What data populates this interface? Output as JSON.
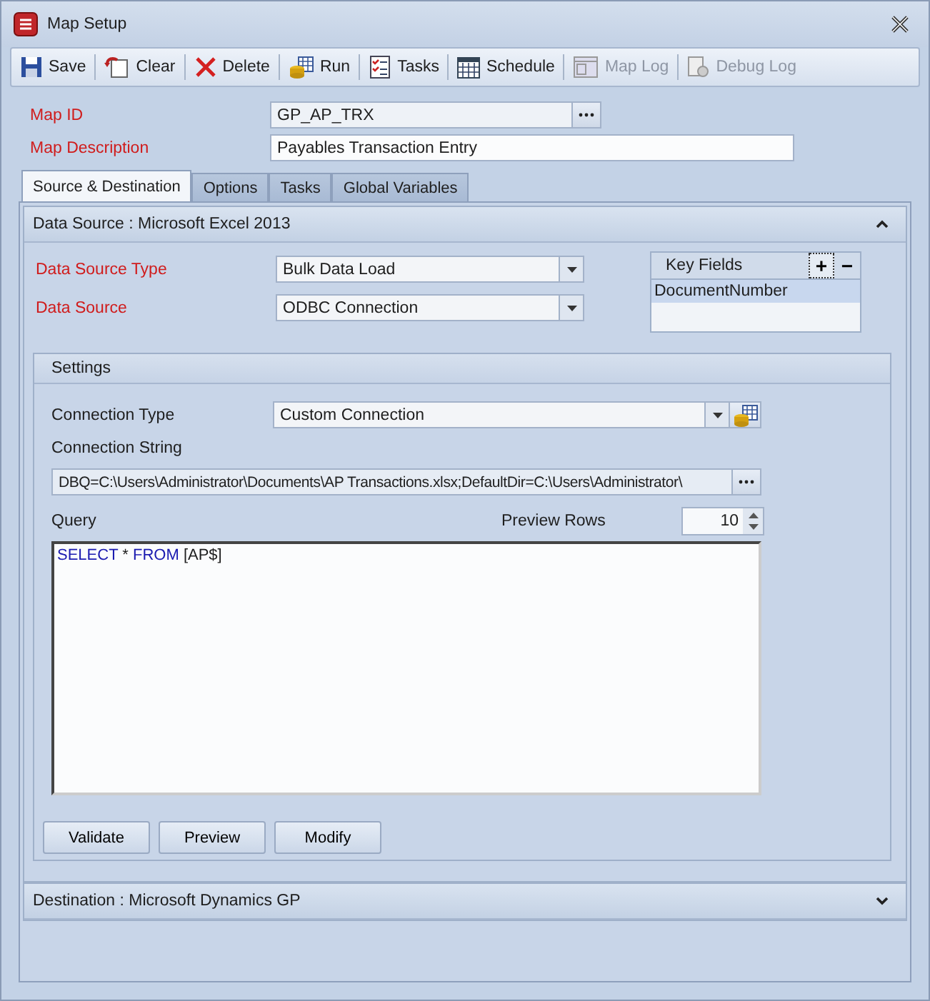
{
  "window": {
    "title": "Map Setup"
  },
  "toolbar": [
    {
      "label": "Save",
      "disabled": false
    },
    {
      "label": "Clear",
      "disabled": false
    },
    {
      "label": "Delete",
      "disabled": false
    },
    {
      "label": "Run",
      "disabled": false
    },
    {
      "label": "Tasks",
      "disabled": false
    },
    {
      "label": "Schedule",
      "disabled": false
    },
    {
      "label": "Map Log",
      "disabled": true
    },
    {
      "label": "Debug Log",
      "disabled": true
    }
  ],
  "map_id": {
    "label": "Map ID",
    "value": "GP_AP_TRX"
  },
  "map_description": {
    "label": "Map Description",
    "value": "Payables Transaction Entry"
  },
  "tabs": [
    {
      "label": "Source & Destination",
      "selected": true
    },
    {
      "label": "Options",
      "selected": false
    },
    {
      "label": "Tasks",
      "selected": false
    },
    {
      "label": "Global Variables",
      "selected": false
    }
  ],
  "data_source": {
    "header": "Data Source : Microsoft Excel 2013",
    "expanded": true,
    "type": {
      "label": "Data Source Type",
      "value": "Bulk Data Load"
    },
    "source": {
      "label": "Data Source",
      "value": "ODBC Connection"
    },
    "key_fields": {
      "title": "Key Fields",
      "add": "+",
      "remove": "−",
      "items": [
        {
          "name": "DocumentNumber",
          "selected": true
        }
      ]
    },
    "settings": {
      "title": "Settings",
      "connection_type": {
        "label": "Connection Type",
        "value": "Custom Connection"
      },
      "connection_string": {
        "label": "Connection String",
        "value": "DBQ=C:\\Users\\Administrator\\Documents\\AP Transactions.xlsx;DefaultDir=C:\\Users\\Administrator\\"
      },
      "query_label": "Query",
      "preview_rows": {
        "label": "Preview Rows",
        "value": "10"
      },
      "query": [
        {
          "kind": "keyword",
          "text": "SELECT"
        },
        {
          "kind": "plain",
          "text": " * "
        },
        {
          "kind": "keyword",
          "text": "FROM"
        },
        {
          "kind": "plain",
          "text": " [AP$]"
        }
      ],
      "buttons": [
        "Validate",
        "Preview",
        "Modify"
      ]
    }
  },
  "destination": {
    "header": "Destination : Microsoft Dynamics GP",
    "expanded": false
  }
}
